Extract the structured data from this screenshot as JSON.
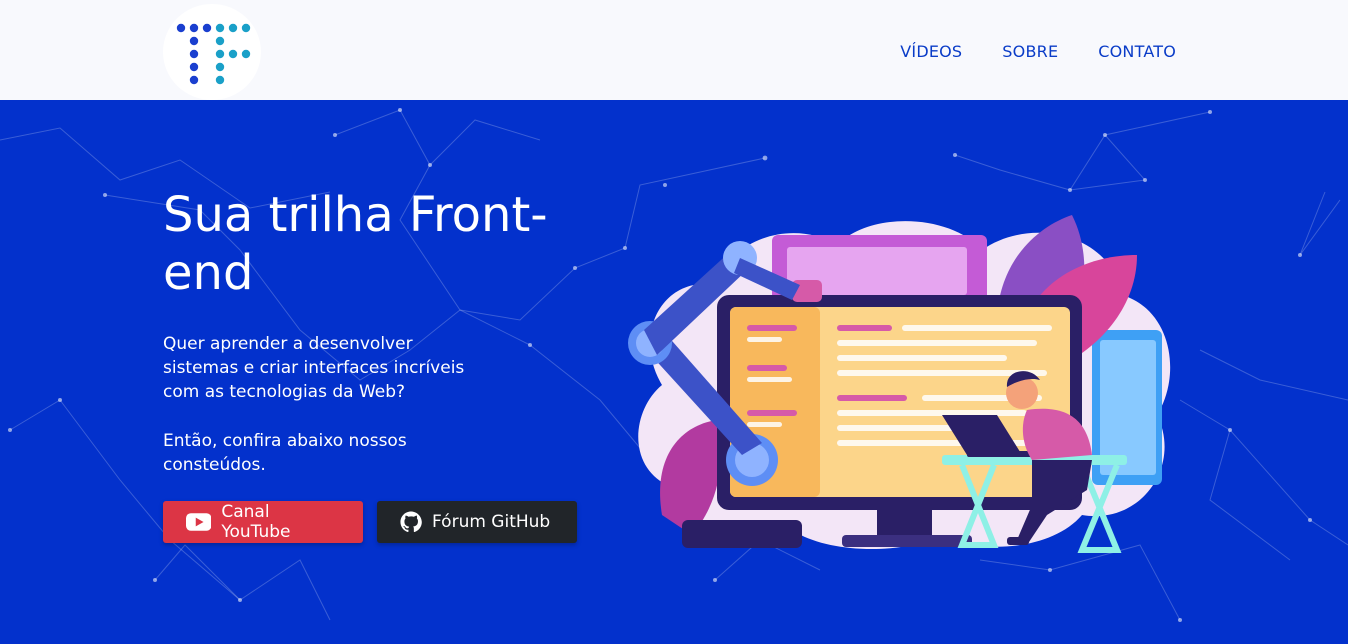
{
  "nav": {
    "items": [
      {
        "label": "VÍDEOS"
      },
      {
        "label": "SOBRE"
      },
      {
        "label": "CONTATO"
      }
    ]
  },
  "hero": {
    "title": "Sua trilha Front-end",
    "paragraph1": "Quer aprender a desenvolver sistemas e criar interfaces incríveis com as tecnologias da Web?",
    "paragraph2": "Então, confira abaixo nossos consteúdos.",
    "buttons": {
      "youtube": "Canal YouTube",
      "github": "Fórum GitHub"
    }
  },
  "colors": {
    "topbar": "#f8f9fd",
    "hero_background": "#0331cc",
    "nav_link": "#0a3cc8",
    "youtube_button": "#dc3545",
    "github_button": "#212529"
  },
  "icons": {
    "logo": "tf-dotted-logo",
    "youtube": "youtube-icon",
    "github": "github-icon"
  }
}
